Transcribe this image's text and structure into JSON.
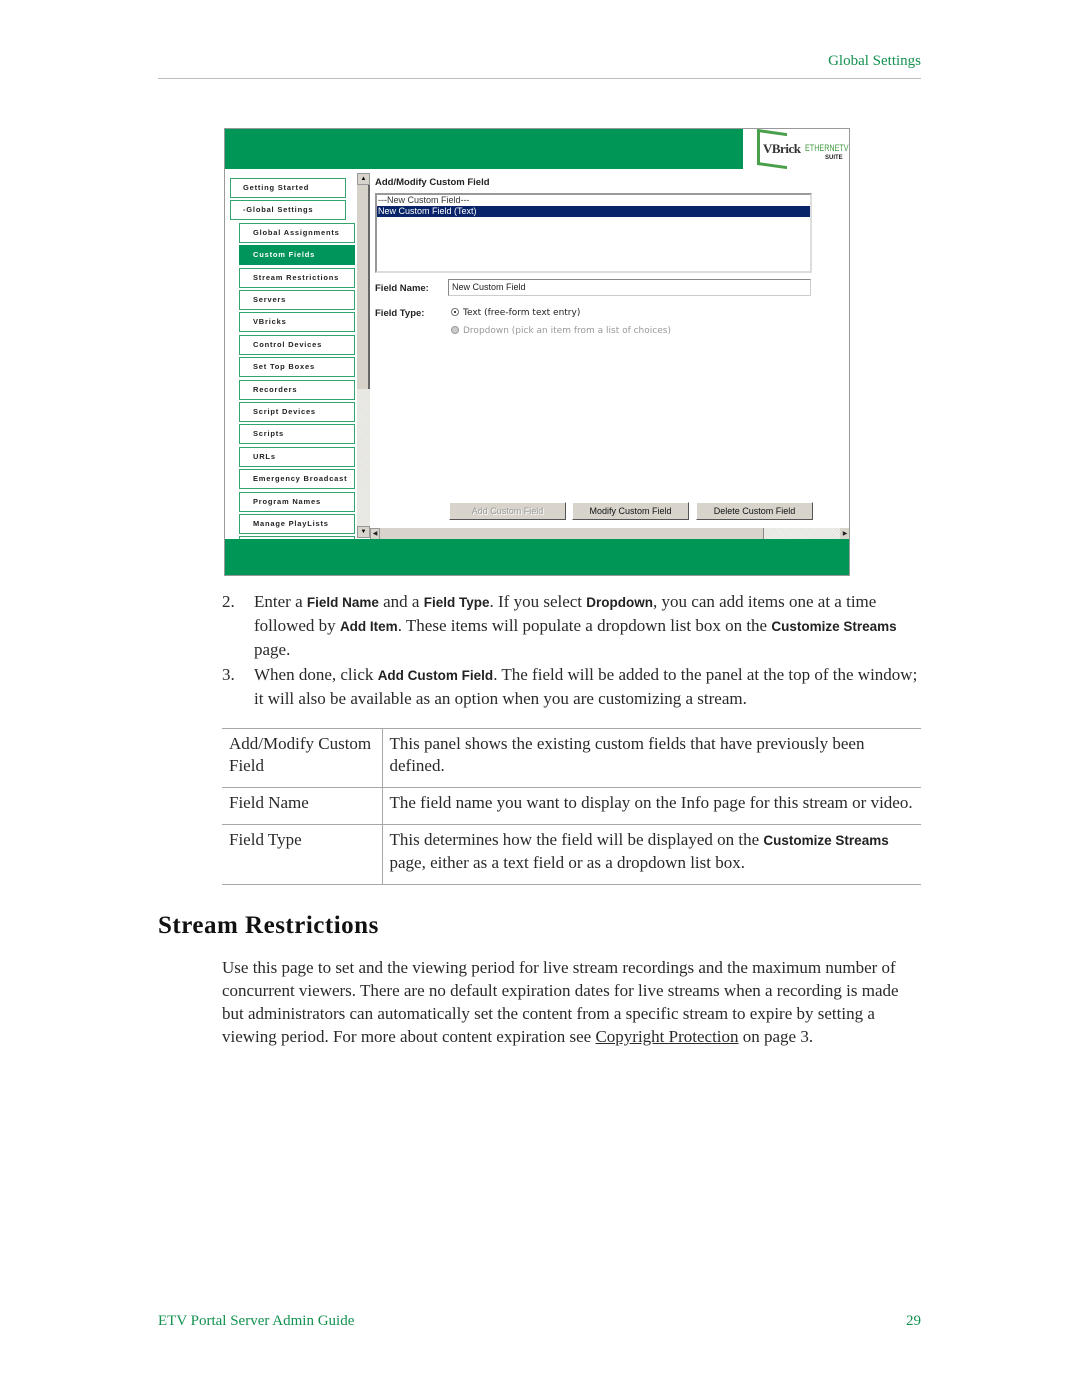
{
  "running_header": "Global Settings",
  "screenshot": {
    "logo": {
      "brand": "VBrick",
      "product": "ETHERNETV",
      "suite": "SUITE"
    },
    "nav_items": [
      {
        "label": "Getting Started",
        "level": "top",
        "active": false
      },
      {
        "label": "-Global Settings",
        "level": "top",
        "active": false
      },
      {
        "label": "Global Assignments",
        "level": "sub",
        "active": false
      },
      {
        "label": "Custom Fields",
        "level": "sub",
        "active": true
      },
      {
        "label": "Stream Restrictions",
        "level": "sub",
        "active": false
      },
      {
        "label": "Servers",
        "level": "sub",
        "active": false
      },
      {
        "label": "VBricks",
        "level": "sub",
        "active": false
      },
      {
        "label": "Control Devices",
        "level": "sub",
        "active": false
      },
      {
        "label": "Set Top Boxes",
        "level": "sub",
        "active": false
      },
      {
        "label": "Recorders",
        "level": "sub",
        "active": false
      },
      {
        "label": "Script Devices",
        "level": "sub",
        "active": false
      },
      {
        "label": "Scripts",
        "level": "sub",
        "active": false
      },
      {
        "label": "URLs",
        "level": "sub",
        "active": false
      },
      {
        "label": "Emergency Broadcast",
        "level": "sub",
        "active": false
      },
      {
        "label": "Program Names",
        "level": "sub",
        "active": false
      },
      {
        "label": "Manage PlayLists",
        "level": "sub",
        "active": false
      },
      {
        "label": "",
        "level": "sub",
        "active": false
      }
    ],
    "panel_title": "Add/Modify Custom Field",
    "list_options": [
      {
        "label": "---New Custom Field---",
        "selected": false
      },
      {
        "label": "New Custom Field (Text)",
        "selected": true
      }
    ],
    "field_name_label": "Field Name:",
    "field_name_value": "New Custom Field",
    "field_type_label": "Field Type:",
    "field_type_options": [
      {
        "label": "Text (free-form text entry)",
        "checked": true,
        "disabled": false
      },
      {
        "label": "Dropdown (pick an item from a list of choices)",
        "checked": false,
        "disabled": true
      }
    ],
    "buttons": {
      "add": "Add Custom Field",
      "modify": "Modify Custom Field",
      "delete": "Delete Custom Field"
    },
    "scroll_icons": {
      "up": "▲",
      "down": "▼",
      "left": "◀",
      "right": "▶"
    }
  },
  "steps": [
    {
      "num": "2.",
      "parts": [
        {
          "t": "Enter a "
        },
        {
          "ui": "Field Name"
        },
        {
          "t": " and a "
        },
        {
          "ui": "Field Type"
        },
        {
          "t": ". If you select "
        },
        {
          "ui": "Dropdown"
        },
        {
          "t": ", you can add items one at a time followed by "
        },
        {
          "ui": "Add Item"
        },
        {
          "t": ". These items will populate a dropdown list box on the "
        },
        {
          "ui": "Customize Streams"
        },
        {
          "t": " page."
        }
      ]
    },
    {
      "num": "3.",
      "parts": [
        {
          "t": "When done, click "
        },
        {
          "ui": "Add Custom Field"
        },
        {
          "t": ". The field will be added to the panel at the top of the window; it will also be available as an option when you are customizing a stream."
        }
      ]
    }
  ],
  "definitions": [
    {
      "term": "Add/Modify Custom Field",
      "parts": [
        {
          "t": "This panel shows the existing custom fields that have previously been defined."
        }
      ]
    },
    {
      "term": "Field Name",
      "parts": [
        {
          "t": "The field name you want to display on the Info page for this stream or video."
        }
      ]
    },
    {
      "term": "Field Type",
      "parts": [
        {
          "t": "This determines how the field will be displayed on the "
        },
        {
          "ui": "Customize Streams"
        },
        {
          "t": " page, either as a text field or as a dropdown list box."
        }
      ]
    }
  ],
  "section": {
    "title": "Stream Restrictions",
    "body_before_link": "Use this page to set and the viewing period for live stream recordings and the maximum number of concurrent viewers. There are no default expiration dates for live streams when a recording is made but administrators can automatically set the content from a specific stream to expire by setting a viewing period. For more about content expiration see ",
    "link_text": "Copyright Protection",
    "body_after_link": " on page 3."
  },
  "footer": {
    "guide_title": "ETV Portal Server Admin Guide",
    "page_number": "29"
  }
}
